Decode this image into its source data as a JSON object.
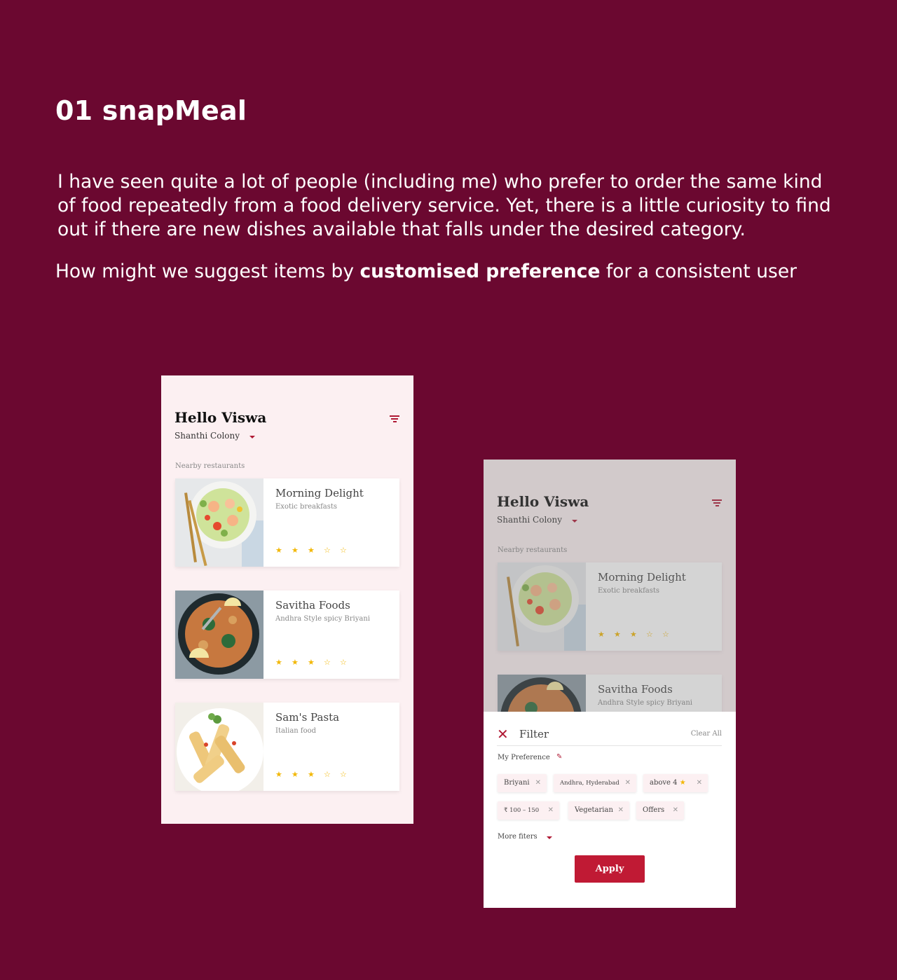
{
  "heading": "01 snapMeal",
  "description": "I have seen quite a lot of people (including me) who prefer to order the same kind of food repeatedly from a food delivery service. Yet, there is a little curiosity to find out if there are new dishes available that falls under the desired category.",
  "hmw": {
    "before": "How might we suggest items by ",
    "bold": "customised preference",
    "after": " for a consistent user"
  },
  "app": {
    "greeting": "Hello Viswa",
    "location": "Shanthi Colony",
    "nearby_label": "Nearby restaurants",
    "star_color": "#f2b705",
    "accent_color": "#b01a35",
    "restaurants": [
      {
        "name": "Morning Delight",
        "subtitle": "Exotic breakfasts",
        "rating": 3
      },
      {
        "name": "Savitha Foods",
        "subtitle": "Andhra Style spicy Briyani",
        "rating": 3
      },
      {
        "name": "Sam's Pasta",
        "subtitle": "Italian food",
        "rating": 3
      }
    ]
  },
  "filter": {
    "title": "Filter",
    "clear_all": "Clear All",
    "my_preference": "My Preference",
    "chips": [
      "Briyani",
      "Andhra, Hyderabad",
      "above 4",
      "₹ 100 – 150",
      "Vegetarian",
      "Offers"
    ],
    "more_filters": "More fiters",
    "apply": "Apply"
  }
}
